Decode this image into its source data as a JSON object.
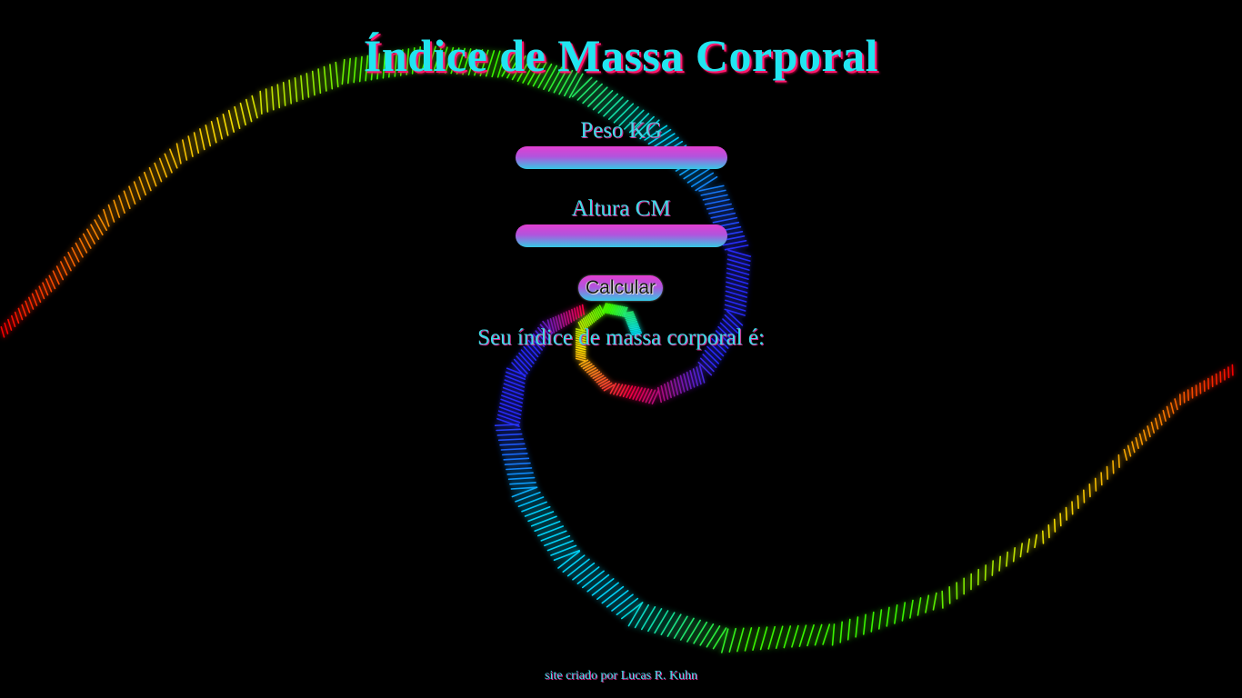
{
  "header": {
    "title": "Índice de Massa Corporal"
  },
  "form": {
    "weight_label": "Peso KG",
    "weight_value": "",
    "height_label": "Altura CM",
    "height_value": "",
    "calculate_label": "Calcular"
  },
  "result": {
    "text": "Seu índice de massa corporal é:"
  },
  "footer": {
    "credit": "site criado por Lucas R. Kuhn"
  },
  "theme": {
    "text_color": "#22e5f0",
    "shadow_color": "#ff1a6e",
    "field_gradient_top": "#e23fd1",
    "field_gradient_bottom": "#35c9e4",
    "background": "#000000",
    "spiral_colors": [
      "#ff0000",
      "#ff8a00",
      "#ffe600",
      "#3cff00",
      "#00d9ff",
      "#2a2bff",
      "#ff0044"
    ]
  }
}
